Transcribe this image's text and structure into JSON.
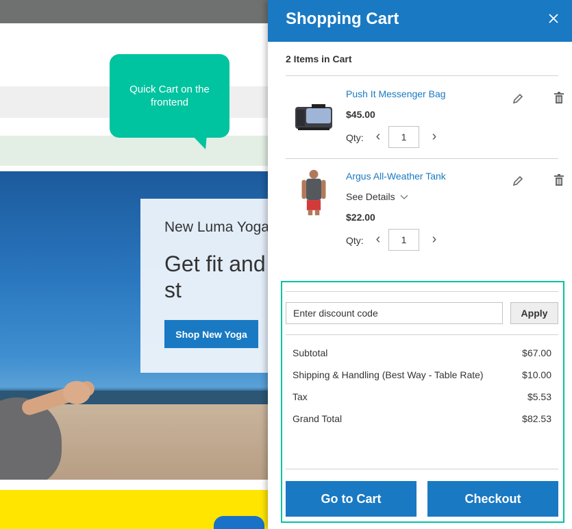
{
  "callout": {
    "text": "Quick Cart on the frontend"
  },
  "hero": {
    "subtitle": "New Luma Yoga",
    "headline": "Get fit and seasonal st",
    "shop_button": "Shop New Yoga"
  },
  "cart": {
    "title": "Shopping Cart",
    "close_icon": "close-icon",
    "items_count": "2 Items in Cart",
    "qty_label": "Qty:",
    "items": [
      {
        "name": "Push It Messenger Bag",
        "price": "$45.00",
        "qty": "1"
      },
      {
        "name": "Argus All-Weather Tank",
        "details": "See Details",
        "price": "$22.00",
        "qty": "1"
      }
    ],
    "discount": {
      "placeholder": "Enter discount code",
      "apply_label": "Apply"
    },
    "totals": [
      {
        "label": "Subtotal",
        "value": "$67.00"
      },
      {
        "label": "Shipping & Handling (Best Way - Table Rate)",
        "value": "$10.00"
      },
      {
        "label": "Tax",
        "value": "$5.53"
      },
      {
        "label": "Grand Total",
        "value": "$82.53"
      }
    ],
    "go_to_cart": "Go to Cart",
    "checkout": "Checkout"
  },
  "colors": {
    "accent": "#1979c3",
    "highlight": "#00c3a0"
  }
}
